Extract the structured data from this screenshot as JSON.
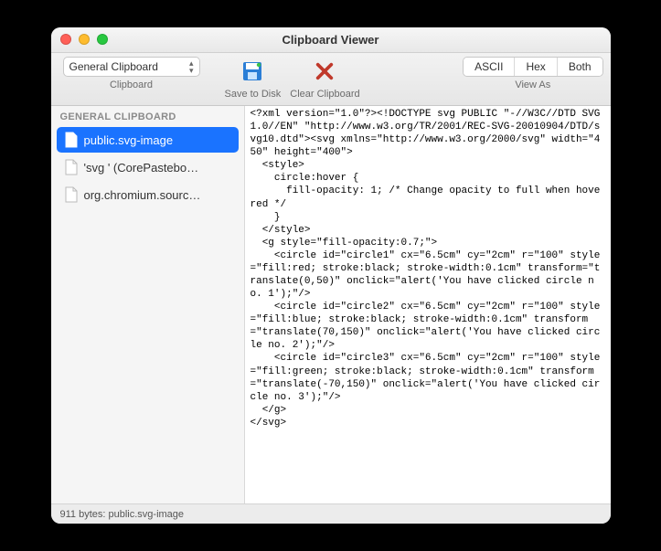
{
  "window": {
    "title": "Clipboard Viewer"
  },
  "toolbar": {
    "clipboard_select": "General Clipboard",
    "clipboard_label": "Clipboard",
    "save_label": "Save to Disk",
    "clear_label": "Clear Clipboard",
    "view_label": "View As",
    "seg": {
      "ascii": "ASCII",
      "hex": "Hex",
      "both": "Both"
    }
  },
  "sidebar": {
    "header": "GENERAL CLIPBOARD",
    "items": [
      {
        "label": "public.svg-image",
        "selected": true
      },
      {
        "label": "'svg ' (CorePastebo…",
        "selected": false
      },
      {
        "label": "org.chromium.sourc…",
        "selected": false
      }
    ]
  },
  "content": "<?xml version=\"1.0\"?><!DOCTYPE svg PUBLIC \"-//W3C//DTD SVG 1.0//EN\" \"http://www.w3.org/TR/2001/REC-SVG-20010904/DTD/svg10.dtd\"><svg xmlns=\"http://www.w3.org/2000/svg\" width=\"450\" height=\"400\">\n  <style>\n    circle:hover {\n      fill-opacity: 1; /* Change opacity to full when hovered */\n    }\n  </style>\n  <g style=\"fill-opacity:0.7;\">\n    <circle id=\"circle1\" cx=\"6.5cm\" cy=\"2cm\" r=\"100\" style=\"fill:red; stroke:black; stroke-width:0.1cm\" transform=\"translate(0,50)\" onclick=\"alert('You have clicked circle no. 1');\"/>\n    <circle id=\"circle2\" cx=\"6.5cm\" cy=\"2cm\" r=\"100\" style=\"fill:blue; stroke:black; stroke-width:0.1cm\" transform=\"translate(70,150)\" onclick=\"alert('You have clicked circle no. 2');\"/>\n    <circle id=\"circle3\" cx=\"6.5cm\" cy=\"2cm\" r=\"100\" style=\"fill:green; stroke:black; stroke-width:0.1cm\" transform=\"translate(-70,150)\" onclick=\"alert('You have clicked circle no. 3');\"/>\n  </g>\n</svg>",
  "status": "911 bytes: public.svg-image"
}
